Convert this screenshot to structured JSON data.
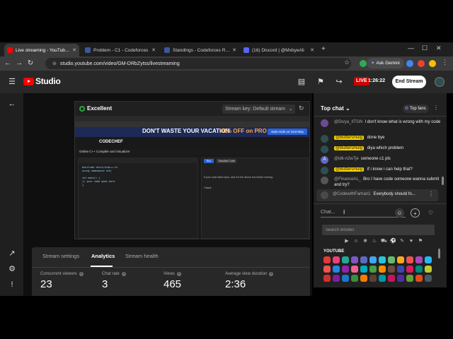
{
  "browser": {
    "tabs": [
      {
        "label": "Live streaming - YouTube Studio",
        "active": true,
        "favicon_color": "#ff0000"
      },
      {
        "label": "Problem - C1 - Codeforces",
        "active": false,
        "favicon_color": "#3b5998"
      },
      {
        "label": "Standings - Codeforces Round",
        "active": false,
        "favicon_color": "#3b5998"
      },
      {
        "label": "(16) Discord | @MxbyeAli",
        "active": false,
        "favicon_color": "#5865f2"
      }
    ],
    "url": "studio.youtube.com/video/GM-DRbZytss/livestreaming",
    "ask_gemini": "Ask Gemini"
  },
  "studio": {
    "logo_text": "Studio",
    "live_badge": "LIVE",
    "elapsed": "1:26:22",
    "end_stream_label": "End Stream"
  },
  "preview": {
    "quality": "Excellent",
    "stream_key": "Stream key: Default stream",
    "banner_text": "DON'T WASTE YOUR VACATION",
    "banner_offer": "40% OFF on PRO",
    "banner_pill": "Sale ends on 31st May",
    "site_logo": "CODECHEF",
    "page_title": "Online C++ Compiler and Visualizer",
    "run": "Run",
    "visualize": "Visualize Code",
    "output_hint": "If your code takes input, add it in the above box before running.",
    "output_label": "Output",
    "code_lines": [
      "#include <bits/stdc++.h>",
      "using namespace std;",
      "",
      "int main() {",
      "    // your code goes here",
      "}"
    ]
  },
  "analytics": {
    "tabs": [
      "Stream settings",
      "Analytics",
      "Stream health"
    ],
    "active_tab": "Analytics",
    "stats": [
      {
        "label": "Concurrent viewers",
        "value": "23"
      },
      {
        "label": "Chat rate",
        "value": "3"
      },
      {
        "label": "Views",
        "value": "465"
      },
      {
        "label": "Average view duration",
        "value": "2:36"
      }
    ]
  },
  "chat": {
    "title": "Top chat",
    "top_fans": "Top fans",
    "messages": [
      {
        "author": "@Divya_IITGN",
        "text": "I don't know what is wrong with my code",
        "owner": false,
        "avatar_color": "#6a4c93"
      },
      {
        "author": "@Buttersmulg",
        "text": "done bye",
        "owner": true,
        "avatar_color": "#2f4f4f"
      },
      {
        "author": "@Buttersmulg",
        "text": "diya which problem",
        "owner": true,
        "avatar_color": "#2f4f4f"
      },
      {
        "author": "@idk-n2w7je",
        "text": "someone c1 pls",
        "owner": false,
        "avatar_color": "#5c6bc0",
        "avatar_letter": "A"
      },
      {
        "author": "@Buttersmulg",
        "text": "if i know i can help that?",
        "owner": true,
        "avatar_color": "#2f4f4f"
      },
      {
        "author": "@FinanceAL_",
        "text": "Bro I have code someone wanna submit and try?",
        "owner": false,
        "avatar_color": "#555555"
      }
    ],
    "pinned": {
      "author": "@CodewithFarhan1",
      "text": "Everybody should fo..."
    },
    "input_placeholder": "Chat...",
    "emoji_search_placeholder": "Search emotes",
    "emoji_section": "YOUTUBE",
    "emote_colors": [
      "#e53935",
      "#ec407a",
      "#26a69a",
      "#7e57c2",
      "#5c6bc0",
      "#42a5f5",
      "#26c6da",
      "#66bb6a",
      "#ffa726",
      "#ef5350",
      "#ab47bc",
      "#29b6f6",
      "#ef5350",
      "#1e88e5",
      "#8e24aa",
      "#f06292",
      "#00acc1",
      "#43a047",
      "#fb8c00",
      "#6d4c41",
      "#3949ab",
      "#d81b60",
      "#00897b",
      "#c0ca33",
      "#d32f2f",
      "#7b1fa2",
      "#1976d2",
      "#388e3c",
      "#f57c00",
      "#5d4037",
      "#0097a7",
      "#c2185b",
      "#512da8",
      "#689f38",
      "#e64a19",
      "#455a64"
    ]
  }
}
